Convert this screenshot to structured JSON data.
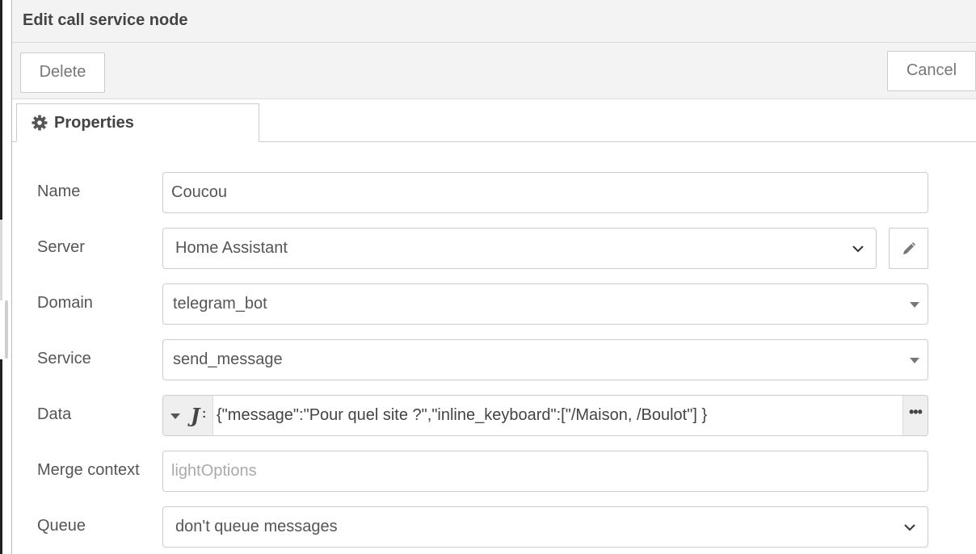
{
  "dialog": {
    "title": "Edit call service node",
    "delete_label": "Delete",
    "cancel_label": "Cancel"
  },
  "tabs": [
    {
      "label": "Properties",
      "icon": "gear-icon",
      "active": true
    }
  ],
  "form": {
    "name": {
      "label": "Name",
      "value": "Coucou"
    },
    "server": {
      "label": "Server",
      "value": "Home Assistant",
      "edit_icon": "pencil-icon"
    },
    "domain": {
      "label": "Domain",
      "value": "telegram_bot"
    },
    "service": {
      "label": "Service",
      "value": "send_message"
    },
    "data": {
      "label": "Data",
      "type_icon": "json-icon",
      "value": "{\"message\":\"Pour quel site ?\",\"inline_keyboard\":[\"/Maison, /Boulot\"] }",
      "expand_icon": "ellipsis-icon"
    },
    "merge_context": {
      "label": "Merge context",
      "placeholder": "lightOptions"
    },
    "queue": {
      "label": "Queue",
      "value": "don't queue messages"
    }
  }
}
